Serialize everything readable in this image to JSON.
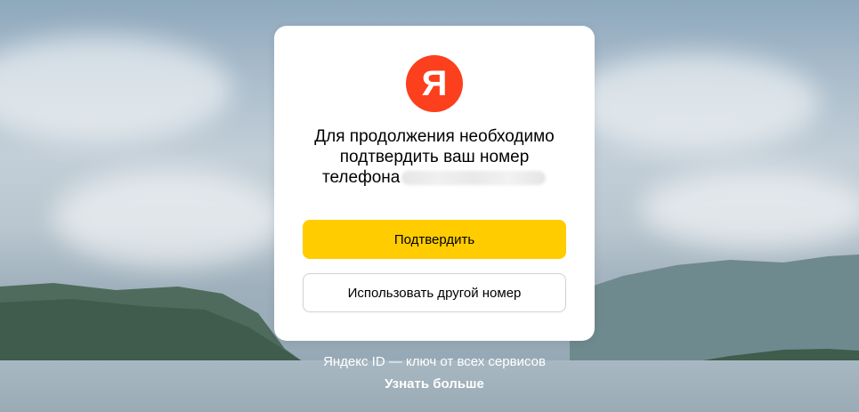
{
  "background": {
    "description_colors": {
      "sky": "#a9bccb",
      "hills": "#4c6a5a",
      "water": "#9aabb6"
    }
  },
  "card": {
    "logo_letter": "Я",
    "logo_color": "#fc3f1d",
    "message_line1": "Для продолжения необходимо",
    "message_line2": "подтвердить ваш номер",
    "message_line3": "телефона",
    "confirm_button": "Подтвердить",
    "confirm_button_color": "#ffcc00",
    "other_number_button": "Использовать другой номер"
  },
  "footer": {
    "tagline": "Яндекс ID — ключ от всех сервисов",
    "learn_more": "Узнать больше"
  }
}
